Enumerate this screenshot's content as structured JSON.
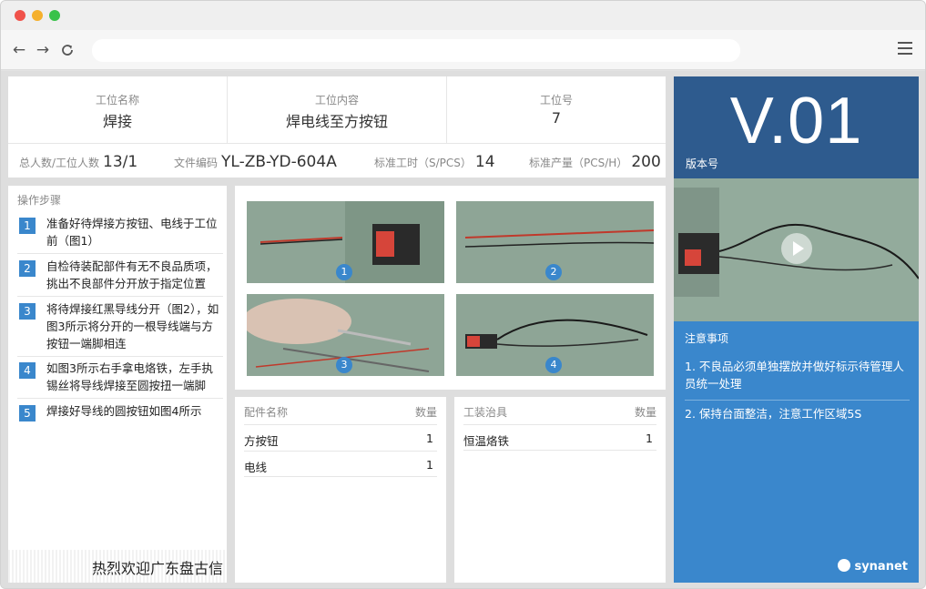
{
  "info": {
    "station_name_label": "工位名称",
    "station_name": "焊接",
    "station_content_label": "工位内容",
    "station_content": "焊电线至方按钮",
    "station_no_label": "工位号",
    "station_no": "7",
    "total_people_label": "总人数/工位人数",
    "total_people": "13/1",
    "doc_code_label": "文件编码",
    "doc_code": "YL-ZB-YD-604A",
    "std_time_label": "标准工时（S/PCS）",
    "std_time": "14",
    "std_output_label": "标准产量（PCS/H）",
    "std_output": "200"
  },
  "version": {
    "number": "V.01",
    "label": "版本号"
  },
  "steps": {
    "title": "操作步骤",
    "items": [
      {
        "num": "1",
        "text": "准备好待焊接方按钮、电线于工位前（图1）"
      },
      {
        "num": "2",
        "text": "自检待装配部件有无不良品质项，挑出不良部件分开放于指定位置"
      },
      {
        "num": "3",
        "text": "将待焊接红黑导线分开（图2），如图3所示将分开的一根导线端与方按钮一端脚相连"
      },
      {
        "num": "4",
        "text": "如图3所示右手拿电烙铁，左手执锡丝将导线焊接至圆按扭一端脚"
      },
      {
        "num": "5",
        "text": "焊接好导线的圆按钮如图4所示"
      }
    ],
    "marquee": "热烈欢迎广东盘古信"
  },
  "photos": {
    "badges": [
      "1",
      "2",
      "3",
      "4"
    ]
  },
  "parts": {
    "header_name": "配件名称",
    "header_qty": "数量",
    "rows": [
      {
        "name": "方按钮",
        "qty": "1"
      },
      {
        "name": "电线",
        "qty": "1"
      }
    ]
  },
  "tools": {
    "header_name": "工装治具",
    "header_qty": "数量",
    "rows": [
      {
        "name": "恒温烙铁",
        "qty": "1"
      }
    ]
  },
  "notes": {
    "title": "注意事项",
    "items": [
      "1. 不良品必须单独摆放并做好标示待管理人员统一处理",
      "2. 保持台面整洁，注意工作区域5S"
    ]
  },
  "brand": {
    "name": "synanet"
  },
  "colors": {
    "accent_blue": "#3a87cc",
    "version_bg": "#2e5b8e",
    "wire_red": "#c0392b"
  },
  "icons": {
    "back": "arrow-left-icon",
    "forward": "arrow-right-icon",
    "reload": "reload-icon",
    "menu": "hamburger-menu-icon",
    "play": "play-icon"
  }
}
